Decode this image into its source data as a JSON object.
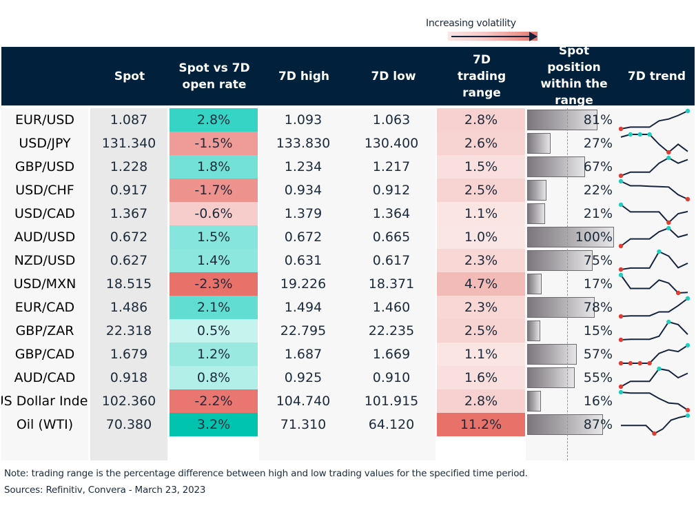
{
  "volatility_legend": {
    "label": "Increasing volatility"
  },
  "headers": {
    "pair": "",
    "spot": "Spot",
    "spot_vs_open": "Spot vs 7D open rate",
    "high": "7D high",
    "low": "7D low",
    "range": "7D trading range",
    "position": "Spot position within the range",
    "trend": "7D trend"
  },
  "colors": {
    "header_bg": "#00203b",
    "positive_strong": "#1ccfbd",
    "negative_strong": "#e8716a",
    "range_high": "#e8716a",
    "range_low": "#fbeceb",
    "trend_line": "#14233a",
    "trend_high_marker": "#1ccfbd",
    "trend_low_marker": "#e23b30"
  },
  "chart_data": {
    "type": "table",
    "title": "",
    "columns": [
      "Pair",
      "Spot",
      "Spot vs 7D open rate",
      "7D high",
      "7D low",
      "7D trading range",
      "Spot position within the range",
      "7D trend"
    ],
    "rows": [
      {
        "pair": "EUR/USD",
        "spot": "1.087",
        "change": "2.8%",
        "change_val": 2.8,
        "high": "1.093",
        "low": "1.063",
        "range": "2.8%",
        "range_val": 2.8,
        "position": "81%",
        "position_val": 0.81,
        "trend": [
          0.0,
          0.1,
          0.1,
          0.1,
          0.45,
          0.55,
          0.75,
          1.0
        ]
      },
      {
        "pair": "USD/JPY",
        "spot": "131.340",
        "change": "-1.5%",
        "change_val": -1.5,
        "high": "133.830",
        "low": "130.400",
        "range": "2.6%",
        "range_val": 2.6,
        "position": "27%",
        "position_val": 0.27,
        "trend": [
          0.85,
          1.0,
          1.0,
          1.0,
          0.45,
          0.0,
          0.45,
          0.05
        ]
      },
      {
        "pair": "GBP/USD",
        "spot": "1.228",
        "change": "1.8%",
        "change_val": 1.8,
        "high": "1.234",
        "low": "1.217",
        "range": "1.5%",
        "range_val": 1.5,
        "position": "67%",
        "position_val": 0.67,
        "trend": [
          0.0,
          0.2,
          0.2,
          0.2,
          0.7,
          1.0,
          0.7,
          0.9
        ]
      },
      {
        "pair": "USD/CHF",
        "spot": "0.917",
        "change": "-1.7%",
        "change_val": -1.7,
        "high": "0.934",
        "low": "0.912",
        "range": "2.5%",
        "range_val": 2.5,
        "position": "22%",
        "position_val": 0.22,
        "trend": [
          1.0,
          0.75,
          0.75,
          0.72,
          0.7,
          0.68,
          0.25,
          0.0
        ]
      },
      {
        "pair": "USD/CAD",
        "spot": "1.367",
        "change": "-0.6%",
        "change_val": -0.6,
        "high": "1.379",
        "low": "1.364",
        "range": "1.1%",
        "range_val": 1.1,
        "position": "21%",
        "position_val": 0.21,
        "trend": [
          1.0,
          0.6,
          0.6,
          0.6,
          0.6,
          0.0,
          0.5,
          0.62
        ]
      },
      {
        "pair": "AUD/USD",
        "spot": "0.672",
        "change": "1.5%",
        "change_val": 1.5,
        "high": "0.672",
        "low": "0.665",
        "range": "1.0%",
        "range_val": 1.0,
        "position": "100%",
        "position_val": 1.0,
        "trend": [
          0.0,
          0.4,
          0.4,
          0.4,
          0.8,
          1.0,
          0.5,
          0.65
        ]
      },
      {
        "pair": "NZD/USD",
        "spot": "0.627",
        "change": "1.4%",
        "change_val": 1.4,
        "high": "0.631",
        "low": "0.617",
        "range": "2.3%",
        "range_val": 2.3,
        "position": "75%",
        "position_val": 0.75,
        "trend": [
          0.0,
          0.08,
          0.08,
          0.08,
          1.0,
          0.75,
          0.1,
          0.35
        ]
      },
      {
        "pair": "USD/MXN",
        "spot": "18.515",
        "change": "-2.3%",
        "change_val": -2.3,
        "high": "19.226",
        "low": "18.371",
        "range": "4.7%",
        "range_val": 4.7,
        "position": "17%",
        "position_val": 0.17,
        "trend": [
          1.0,
          0.25,
          0.25,
          0.25,
          0.72,
          0.55,
          0.0,
          0.03
        ]
      },
      {
        "pair": "EUR/CAD",
        "spot": "1.486",
        "change": "2.1%",
        "change_val": 2.1,
        "high": "1.494",
        "low": "1.460",
        "range": "2.3%",
        "range_val": 2.3,
        "position": "78%",
        "position_val": 0.78,
        "trend": [
          0.0,
          0.03,
          0.03,
          0.03,
          0.25,
          0.25,
          0.6,
          1.0
        ]
      },
      {
        "pair": "GBP/ZAR",
        "spot": "22.318",
        "change": "0.5%",
        "change_val": 0.5,
        "high": "22.795",
        "low": "22.235",
        "range": "2.5%",
        "range_val": 2.5,
        "position": "15%",
        "position_val": 0.15,
        "trend": [
          0.0,
          0.03,
          0.03,
          0.03,
          0.2,
          1.0,
          0.85,
          0.3
        ]
      },
      {
        "pair": "GBP/CAD",
        "spot": "1.679",
        "change": "1.2%",
        "change_val": 1.2,
        "high": "1.687",
        "low": "1.669",
        "range": "1.1%",
        "range_val": 1.1,
        "position": "57%",
        "position_val": 0.57,
        "trend": [
          0.0,
          0.0,
          0.0,
          0.0,
          0.55,
          0.75,
          0.65,
          1.0
        ]
      },
      {
        "pair": "AUD/CAD",
        "spot": "0.918",
        "change": "0.8%",
        "change_val": 0.8,
        "high": "0.925",
        "low": "0.910",
        "range": "1.6%",
        "range_val": 1.6,
        "position": "55%",
        "position_val": 0.55,
        "trend": [
          0.0,
          0.3,
          0.3,
          0.3,
          1.0,
          0.9,
          0.5,
          0.75
        ]
      },
      {
        "pair": "US Dollar Index",
        "spot": "102.360",
        "change": "-2.2%",
        "change_val": -2.2,
        "high": "104.740",
        "low": "101.915",
        "range": "2.8%",
        "range_val": 2.8,
        "position": "16%",
        "position_val": 0.16,
        "trend": [
          1.0,
          0.95,
          0.95,
          0.95,
          0.65,
          0.4,
          0.35,
          0.0
        ]
      },
      {
        "pair": "Oil (WTI)",
        "spot": "70.380",
        "change": "3.2%",
        "change_val": 3.2,
        "high": "71.310",
        "low": "64.120",
        "range": "11.2%",
        "range_val": 11.2,
        "position": "87%",
        "position_val": 0.87,
        "trend": [
          0.45,
          0.45,
          0.45,
          0.45,
          0.0,
          0.25,
          0.75,
          0.9,
          1.0
        ]
      }
    ]
  },
  "footer": {
    "note": "Note: trading range is the percentage difference between high and low trading values for the specified time period.",
    "source": "Sources: Refinitiv, Convera - March 23, 2023"
  }
}
